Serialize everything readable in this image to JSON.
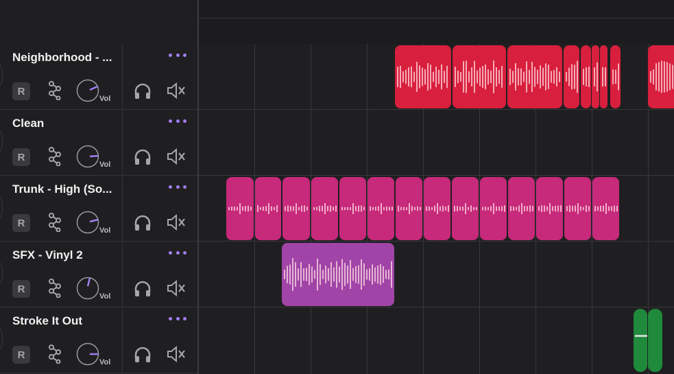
{
  "tracks": [
    {
      "name": "Neighborhood - ...",
      "rec_label": "R",
      "knob_label": "Vol",
      "clip_color": "#d81f3d"
    },
    {
      "name": "Clean",
      "rec_label": "R",
      "knob_label": "Vol",
      "clip_color": ""
    },
    {
      "name": "Trunk - High (So...",
      "rec_label": "R",
      "knob_label": "Vol",
      "clip_color": "#c7297b"
    },
    {
      "name": "SFX - Vinyl 2",
      "rec_label": "R",
      "knob_label": "Vol",
      "clip_color": "#a144a8"
    },
    {
      "name": "Stroke It Out",
      "rec_label": "R",
      "knob_label": "Vol",
      "clip_color": "#1f8a3c"
    }
  ],
  "icons": {
    "more": "more-options-icon",
    "automation": "automation-icon",
    "volume_knob": "volume-knob",
    "solo": "headphones-icon",
    "mute": "speaker-mute-icon"
  },
  "colors": {
    "accent": "#a17ff0",
    "background": "#1f1f21",
    "grid": "#38383b"
  }
}
